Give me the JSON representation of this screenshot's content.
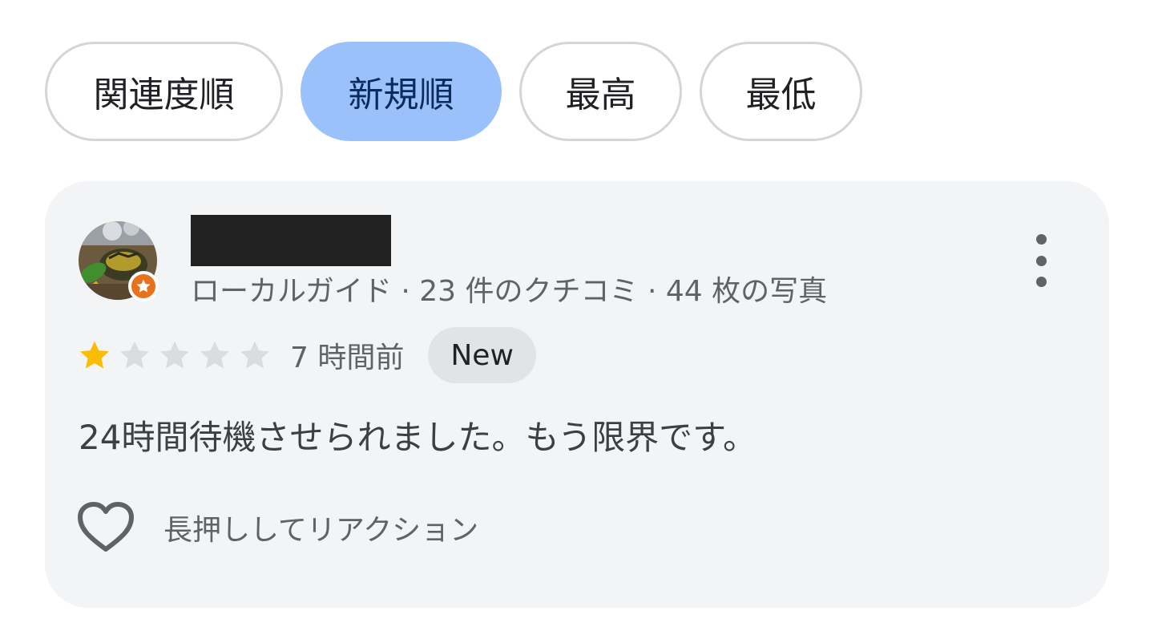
{
  "sort_chips": [
    {
      "label": "関連度順",
      "selected": false
    },
    {
      "label": "新規順",
      "selected": true
    },
    {
      "label": "最高",
      "selected": false
    },
    {
      "label": "最低",
      "selected": false
    }
  ],
  "review": {
    "reviewer_meta": "ローカルガイド · 23 件のクチコミ · 44 枚の写真",
    "rating": 1,
    "rating_max": 5,
    "time_ago": "7 時間前",
    "badge": "New",
    "text": "24時間待機させられました。もう限界です。",
    "reaction_label": "長押ししてリアクション"
  },
  "icons": {
    "more": "more-vert-icon",
    "heart": "heart-outline-icon",
    "guide": "local-guide-star-icon"
  },
  "colors": {
    "selected_chip": "#9bc1fb",
    "star_filled": "#fbbc04",
    "star_empty": "#dadce0",
    "guide_badge": "#e8711c",
    "card_bg": "#f3f4f6"
  }
}
